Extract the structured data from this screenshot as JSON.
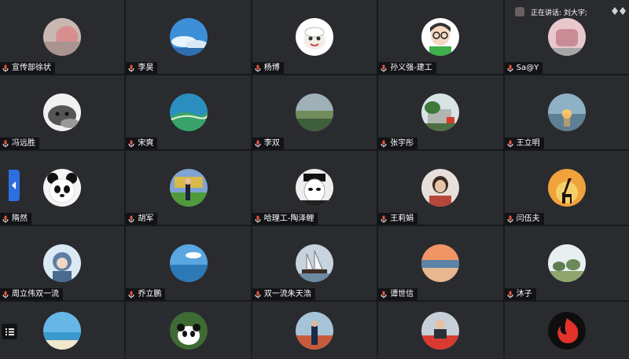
{
  "speaking": {
    "label": "正在讲话: 刘大宇;"
  },
  "participants": [
    {
      "name": "宣传部徐状",
      "avatar": "photo-object-avatar"
    },
    {
      "name": "李昊",
      "avatar": "sky-clouds-avatar"
    },
    {
      "name": "杨博",
      "avatar": "cartoon-goat-avatar"
    },
    {
      "name": "孙义强-建工",
      "avatar": "cartoon-boy-glasses-avatar"
    },
    {
      "name": "Sa@Y",
      "avatar": "pink-cartoon-avatar"
    },
    {
      "name": "冯远胜",
      "avatar": "cat-avatar"
    },
    {
      "name": "宋爽",
      "avatar": "coastline-aerial-avatar"
    },
    {
      "name": "李双",
      "avatar": "landscape-field-avatar"
    },
    {
      "name": "张宇彤",
      "avatar": "building-tree-avatar"
    },
    {
      "name": "王立明",
      "avatar": "sunset-sea-avatar"
    },
    {
      "name": "隋然",
      "avatar": "panda-avatar"
    },
    {
      "name": "胡军",
      "avatar": "person-outdoor-avatar"
    },
    {
      "name": "哈理工-陶泽鲤",
      "avatar": "masked-face-avatar"
    },
    {
      "name": "王莉娟",
      "avatar": "woman-photo-avatar"
    },
    {
      "name": "闫伍夫",
      "avatar": "giraffe-sunset-avatar"
    },
    {
      "name": "周立伟双一流",
      "avatar": "cartoon-character-avatar"
    },
    {
      "name": "乔立鹏",
      "avatar": "blue-sky-sea-avatar"
    },
    {
      "name": "双一流朱天浩",
      "avatar": "sailing-ship-avatar"
    },
    {
      "name": "谭世信",
      "avatar": "beach-sunset-avatar"
    },
    {
      "name": "沐子",
      "avatar": "field-trees-avatar"
    },
    {
      "name": "",
      "avatar": "beach-sky-avatar"
    },
    {
      "name": "",
      "avatar": "panda-tree-avatar"
    },
    {
      "name": "",
      "avatar": "person-standing-avatar"
    },
    {
      "name": "",
      "avatar": "person-stage-avatar"
    },
    {
      "name": "",
      "avatar": "red-logo-avatar"
    }
  ],
  "colors": {
    "accent": "#2d6fe0",
    "tile": "#2a2b2f",
    "name_tag": "#121316",
    "mic": "#e8543d"
  }
}
